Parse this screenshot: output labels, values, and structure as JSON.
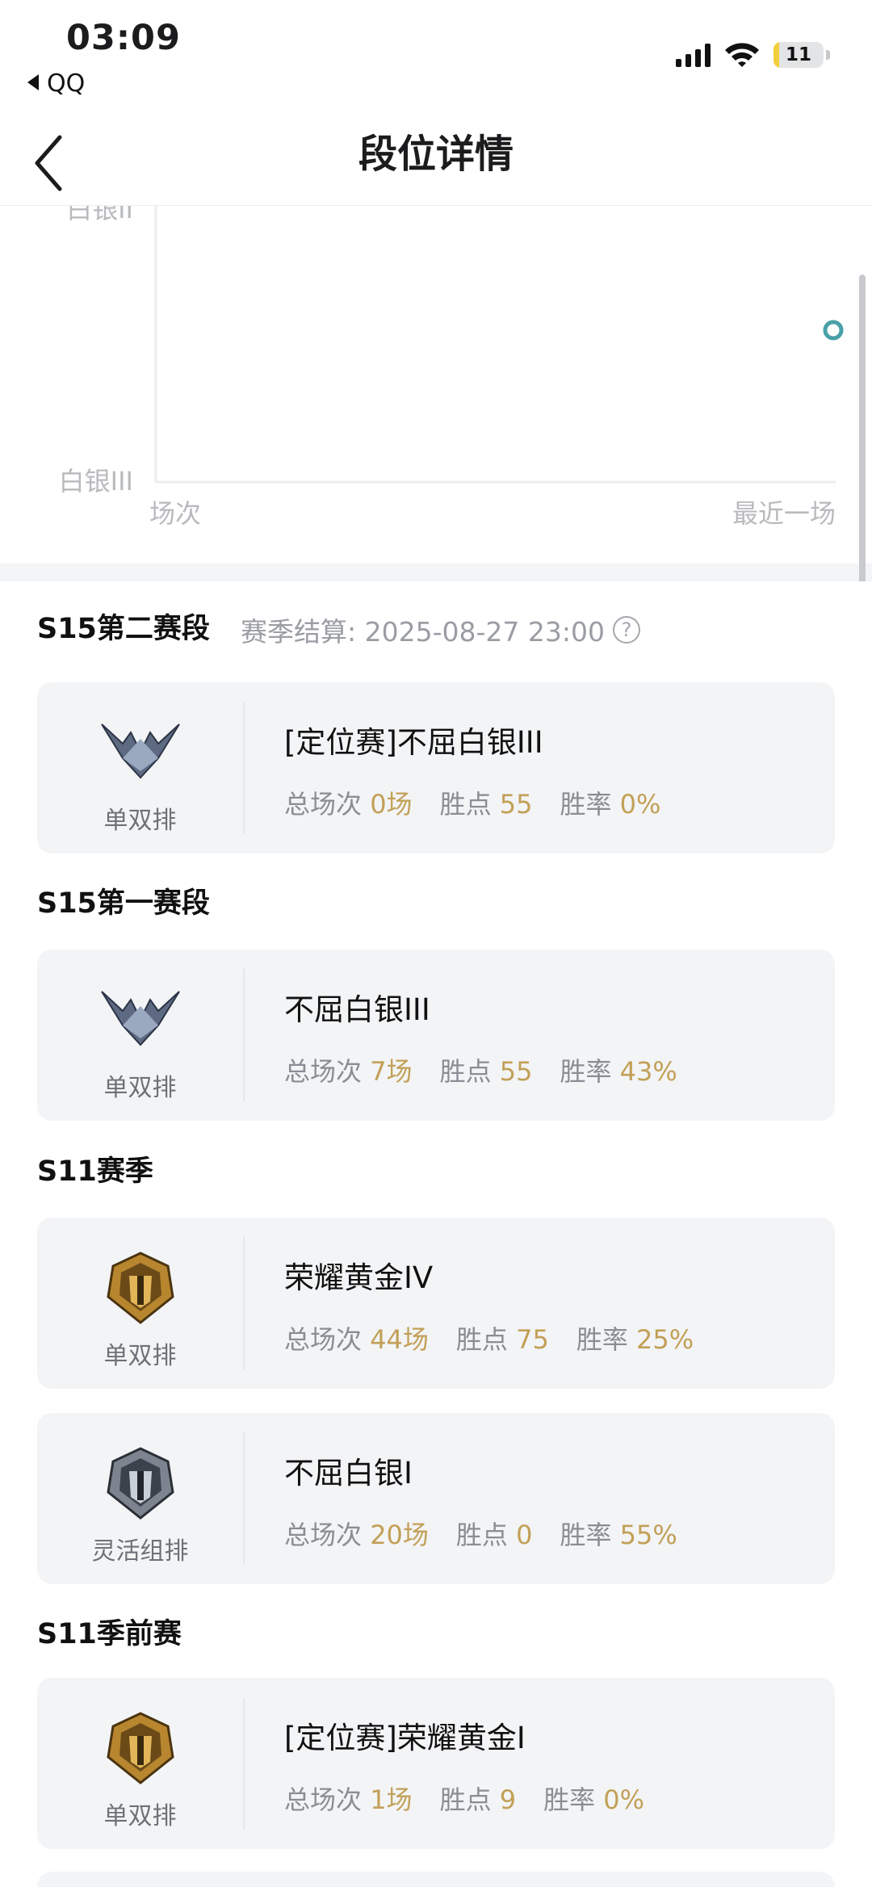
{
  "status_bar": {
    "time": "03:09",
    "back_app": "QQ",
    "battery": "11",
    "battery_level": 0.11
  },
  "header": {
    "title": "段位详情",
    "back_icon": "chevron-left-icon"
  },
  "chart": {
    "y_top_label": "白银II",
    "y_bottom_label": "白银III",
    "x_left_label": "场次",
    "x_right_label": "最近一场"
  },
  "chart_data": {
    "type": "scatter",
    "title": "",
    "xlabel": "",
    "ylabel": "",
    "x_tick_labels": [
      "场次",
      "最近一场"
    ],
    "y_tick_labels": [
      "白银III",
      "白银II"
    ],
    "series": [
      {
        "x": [
          "最近一场"
        ],
        "values": [
          0.55
        ]
      }
    ],
    "ylim": [
      0,
      1
    ],
    "grid": false,
    "point_color": "#4aa0a8"
  },
  "sections": [
    {
      "title": "S15第二赛段",
      "settlement": "赛季结算: 2025-08-27 23:00",
      "cards": [
        {
          "queue": "单双排",
          "rank": "[定位赛]不屈白银III",
          "games_label": "总场次",
          "games": "0场",
          "lp_label": "胜点",
          "lp": "55",
          "wr_label": "胜率",
          "wr": "0%",
          "emblem": "silver-emblem-icon"
        }
      ]
    },
    {
      "title": "S15第一赛段",
      "cards": [
        {
          "queue": "单双排",
          "rank": "不屈白银III",
          "games_label": "总场次",
          "games": "7场",
          "lp_label": "胜点",
          "lp": "55",
          "wr_label": "胜率",
          "wr": "43%",
          "emblem": "silver-emblem-icon"
        }
      ]
    },
    {
      "title": "S11赛季",
      "cards": [
        {
          "queue": "单双排",
          "rank": "荣耀黄金IV",
          "games_label": "总场次",
          "games": "44场",
          "lp_label": "胜点",
          "lp": "75",
          "wr_label": "胜率",
          "wr": "25%",
          "emblem": "gold-emblem-icon"
        },
        {
          "queue": "灵活组排",
          "rank": "不屈白银I",
          "games_label": "总场次",
          "games": "20场",
          "lp_label": "胜点",
          "lp": "0",
          "wr_label": "胜率",
          "wr": "55%",
          "emblem": "silver-helm-emblem-icon"
        }
      ]
    },
    {
      "title": "S11季前赛",
      "cards": [
        {
          "queue": "单双排",
          "rank": "[定位赛]荣耀黄金I",
          "games_label": "总场次",
          "games": "1场",
          "lp_label": "胜点",
          "lp": "9",
          "wr_label": "胜率",
          "wr": "0%",
          "emblem": "gold-emblem-icon"
        }
      ]
    }
  ],
  "colors": {
    "value_gold": "#c2a057",
    "card_bg": "#f3f4f6",
    "accent_teal": "#4aa0a8"
  }
}
